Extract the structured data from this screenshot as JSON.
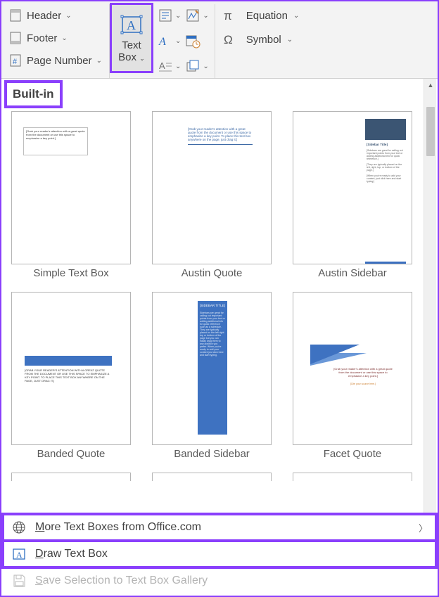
{
  "ribbon": {
    "header_label": "Header",
    "footer_label": "Footer",
    "pagenum_label": "Page Number",
    "textbox_label": "Text",
    "textbox_label2": "Box",
    "equation_label": "Equation",
    "symbol_label": "Symbol"
  },
  "section": {
    "builtin": "Built-in"
  },
  "gallery": [
    {
      "label": "Simple Text Box"
    },
    {
      "label": "Austin Quote"
    },
    {
      "label": "Austin Sidebar"
    },
    {
      "label": "Banded Quote"
    },
    {
      "label": "Banded Sidebar"
    },
    {
      "label": "Facet Quote"
    }
  ],
  "menu": {
    "more": "ore Text Boxes from Office.com",
    "more_key": "M",
    "draw": "raw Text Box",
    "draw_key": "D",
    "save": "ave Selection to Text Box Gallery",
    "save_key": "S"
  }
}
